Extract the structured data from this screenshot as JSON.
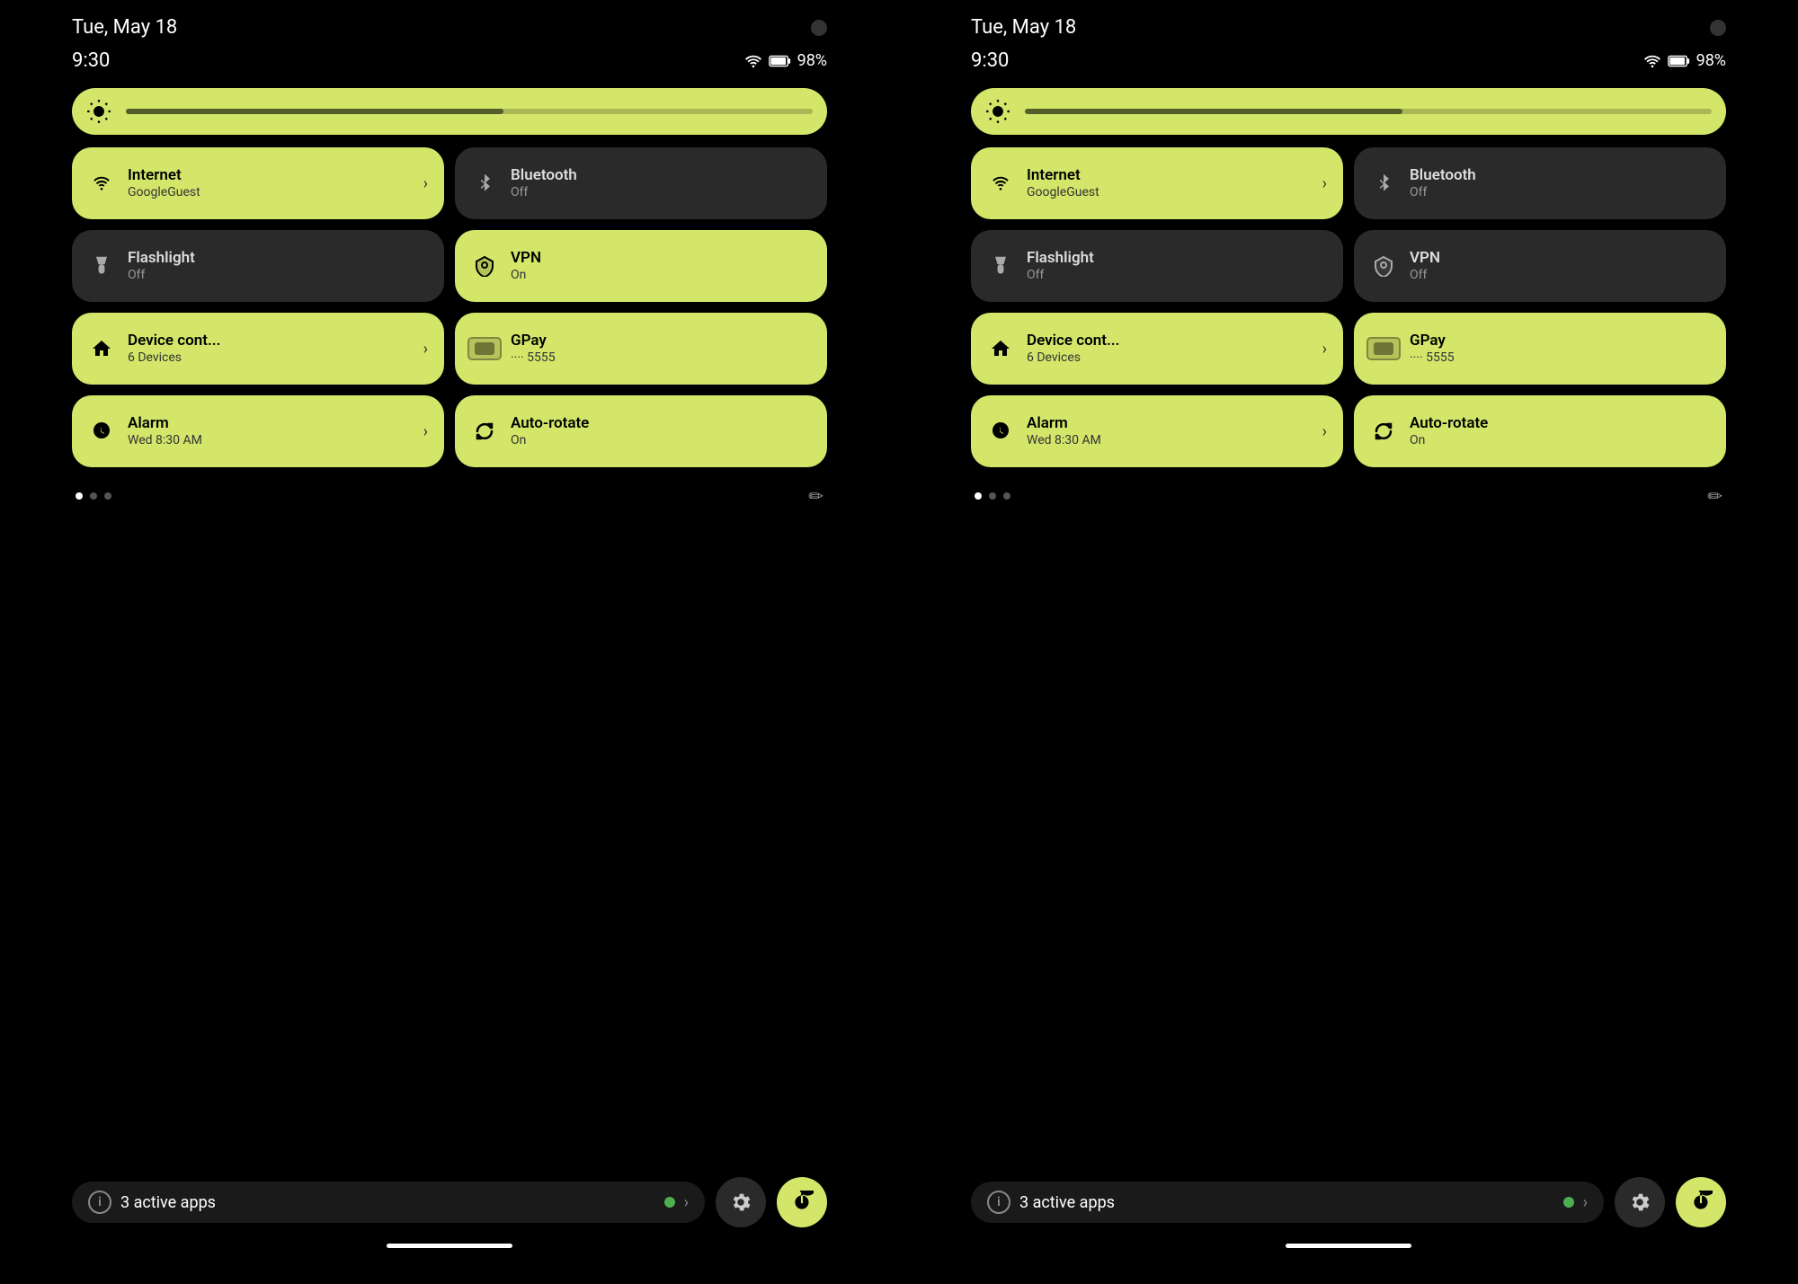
{
  "panels": [
    {
      "id": "left",
      "status": {
        "date": "Tue, May 18",
        "time": "9:30",
        "battery": "98%"
      },
      "brightness": {
        "fill_percent": 55
      },
      "tiles": [
        {
          "id": "internet",
          "active": true,
          "icon": "wifi",
          "title": "Internet",
          "subtitle": "GoogleGuest",
          "has_chevron": true
        },
        {
          "id": "bluetooth",
          "active": false,
          "icon": "bluetooth",
          "title": "Bluetooth",
          "subtitle": "Off",
          "has_chevron": false
        },
        {
          "id": "flashlight",
          "active": false,
          "icon": "flashlight",
          "title": "Flashlight",
          "subtitle": "Off",
          "has_chevron": false
        },
        {
          "id": "vpn",
          "active": true,
          "icon": "vpn",
          "title": "VPN",
          "subtitle": "On",
          "has_chevron": false
        },
        {
          "id": "device",
          "active": true,
          "icon": "home",
          "title": "Device cont...",
          "subtitle": "6 Devices",
          "has_chevron": true
        },
        {
          "id": "gpay",
          "active": true,
          "icon": "gpay",
          "title": "GPay",
          "subtitle": "···· 5555",
          "has_chevron": false
        },
        {
          "id": "alarm",
          "active": true,
          "icon": "alarm",
          "title": "Alarm",
          "subtitle": "Wed 8:30 AM",
          "has_chevron": true
        },
        {
          "id": "autorotate",
          "active": true,
          "icon": "rotate",
          "title": "Auto-rotate",
          "subtitle": "On",
          "has_chevron": false
        }
      ],
      "bottom": {
        "active_apps": "3 active apps",
        "settings_label": "Settings",
        "power_label": "Power"
      }
    },
    {
      "id": "right",
      "status": {
        "date": "Tue, May 18",
        "time": "9:30",
        "battery": "98%"
      },
      "brightness": {
        "fill_percent": 55
      },
      "tiles": [
        {
          "id": "internet",
          "active": true,
          "icon": "wifi",
          "title": "Internet",
          "subtitle": "GoogleGuest",
          "has_chevron": true
        },
        {
          "id": "bluetooth",
          "active": false,
          "icon": "bluetooth",
          "title": "Bluetooth",
          "subtitle": "Off",
          "has_chevron": false
        },
        {
          "id": "flashlight",
          "active": false,
          "icon": "flashlight",
          "title": "Flashlight",
          "subtitle": "Off",
          "has_chevron": false
        },
        {
          "id": "vpn",
          "active": false,
          "icon": "vpn",
          "title": "VPN",
          "subtitle": "Off",
          "has_chevron": false
        },
        {
          "id": "device",
          "active": true,
          "icon": "home",
          "title": "Device cont...",
          "subtitle": "6 Devices",
          "has_chevron": true
        },
        {
          "id": "gpay",
          "active": true,
          "icon": "gpay",
          "title": "GPay",
          "subtitle": "···· 5555",
          "has_chevron": false
        },
        {
          "id": "alarm",
          "active": true,
          "icon": "alarm",
          "title": "Alarm",
          "subtitle": "Wed 8:30 AM",
          "has_chevron": true
        },
        {
          "id": "autorotate",
          "active": true,
          "icon": "rotate",
          "title": "Auto-rotate",
          "subtitle": "On",
          "has_chevron": false
        }
      ],
      "bottom": {
        "active_apps": "3 active apps",
        "settings_label": "Settings",
        "power_label": "Power"
      }
    }
  ],
  "icons": {
    "wifi": "▼",
    "bluetooth": "✻",
    "flashlight": "🔦",
    "vpn": "🛡",
    "home": "⌂",
    "gpay": "💳",
    "alarm": "⏰",
    "rotate": "↻",
    "brightness": "✦",
    "edit": "✏",
    "info": "i",
    "chevron": "›",
    "settings": "⚙",
    "power": "⏻",
    "battery": "🔋",
    "wifi_signal": "▾"
  }
}
